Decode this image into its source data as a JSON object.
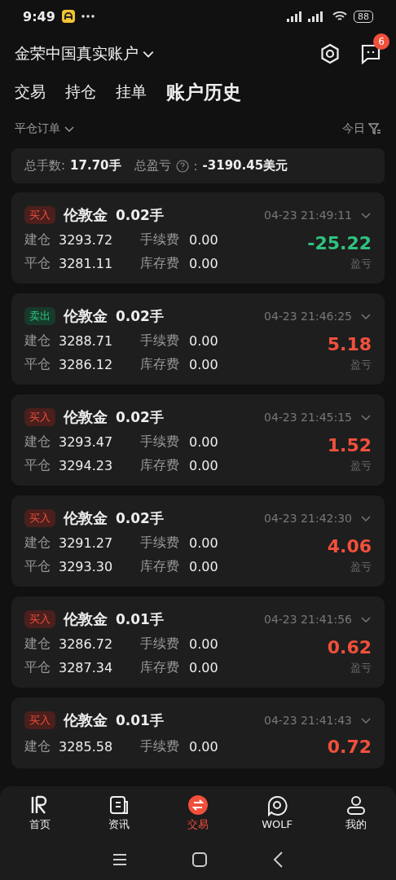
{
  "status_bar": {
    "time": "9:49",
    "battery": "88"
  },
  "header": {
    "account": "金荣中国真实账户",
    "badge": "6"
  },
  "tabs": [
    {
      "label": "交易",
      "selected": false
    },
    {
      "label": "持仓",
      "selected": false
    },
    {
      "label": "挂单",
      "selected": false
    },
    {
      "label": "账户历史",
      "selected": true
    }
  ],
  "filter": {
    "type": "平仓订单",
    "period": "今日"
  },
  "summary": {
    "lots_label": "总手数:",
    "lots": "17.70手",
    "pnl_label": "总盈亏",
    "pnl_colon": ":",
    "pnl": "-3190.45美元"
  },
  "orders": [
    {
      "kind": "buy",
      "side_label": "买入",
      "symbol": "伦敦金",
      "lots": "0.02手",
      "time": "04-23 21:49:11",
      "open_label": "建仓",
      "open": "3293.72",
      "fee_label": "手续费",
      "fee": "0.00",
      "close_label": "平仓",
      "close": "3281.11",
      "swap_label": "库存费",
      "swap": "0.00",
      "color": "#2fc37f",
      "pnl": "-25.22",
      "pnl_label": "盈亏"
    },
    {
      "kind": "sell",
      "side_label": "卖出",
      "symbol": "伦敦金",
      "lots": "0.02手",
      "time": "04-23 21:46:25",
      "open_label": "建仓",
      "open": "3288.71",
      "fee_label": "手续费",
      "fee": "0.00",
      "close_label": "平仓",
      "close": "3286.12",
      "swap_label": "库存费",
      "swap": "0.00",
      "color": "#f0503c",
      "pnl": "5.18",
      "pnl_label": "盈亏"
    },
    {
      "kind": "buy",
      "side_label": "买入",
      "symbol": "伦敦金",
      "lots": "0.02手",
      "time": "04-23 21:45:15",
      "open_label": "建仓",
      "open": "3293.47",
      "fee_label": "手续费",
      "fee": "0.00",
      "close_label": "平仓",
      "close": "3294.23",
      "swap_label": "库存费",
      "swap": "0.00",
      "color": "#f0503c",
      "pnl": "1.52",
      "pnl_label": "盈亏"
    },
    {
      "kind": "buy",
      "side_label": "买入",
      "symbol": "伦敦金",
      "lots": "0.02手",
      "time": "04-23 21:42:30",
      "open_label": "建仓",
      "open": "3291.27",
      "fee_label": "手续费",
      "fee": "0.00",
      "close_label": "平仓",
      "close": "3293.30",
      "swap_label": "库存费",
      "swap": "0.00",
      "color": "#f0503c",
      "pnl": "4.06",
      "pnl_label": "盈亏"
    },
    {
      "kind": "buy",
      "side_label": "买入",
      "symbol": "伦敦金",
      "lots": "0.01手",
      "time": "04-23 21:41:56",
      "open_label": "建仓",
      "open": "3286.72",
      "fee_label": "手续费",
      "fee": "0.00",
      "close_label": "平仓",
      "close": "3287.34",
      "swap_label": "库存费",
      "swap": "0.00",
      "color": "#f0503c",
      "pnl": "0.62",
      "pnl_label": "盈亏"
    },
    {
      "kind": "buy",
      "side_label": "买入",
      "symbol": "伦敦金",
      "lots": "0.01手",
      "time": "04-23 21:41:43",
      "open_label": "建仓",
      "open": "3285.58",
      "fee_label": "手续费",
      "fee": "0.00",
      "color": "#f0503c",
      "pnl": "0.72"
    }
  ],
  "bottom_nav": [
    {
      "label": "首页",
      "selected": false
    },
    {
      "label": "资讯",
      "selected": false
    },
    {
      "label": "交易",
      "selected": true
    },
    {
      "label": "WOLF",
      "selected": false
    },
    {
      "label": "我的",
      "selected": false
    }
  ]
}
